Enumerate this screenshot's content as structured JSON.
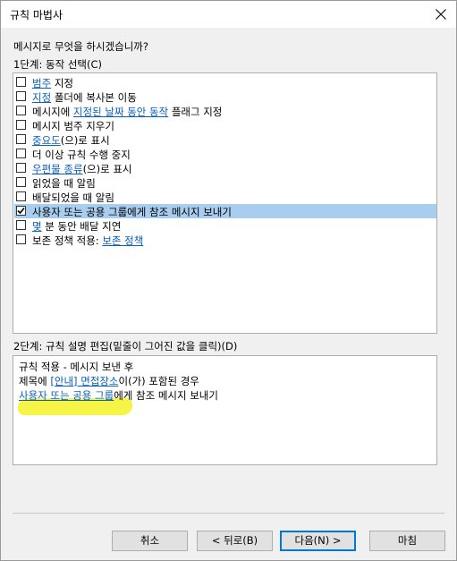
{
  "window": {
    "title": "규칙 마법사"
  },
  "question": "메시지로 무엇을 하시겠습니까?",
  "step1_label": "1단계: 동작 선택(C)",
  "actions": [
    {
      "checked": false,
      "link": "범주",
      "after": " 지정"
    },
    {
      "checked": false,
      "link": "지정",
      "after": " 폴더에 복사본 이동"
    },
    {
      "checked": false,
      "before": "메시지에 ",
      "link": "지정된 날짜 동안 동작",
      "after": " 플래그 지정"
    },
    {
      "checked": false,
      "before": "메시지 범주 지우기"
    },
    {
      "checked": false,
      "link": "중요도",
      "after": "(으)로 표시"
    },
    {
      "checked": false,
      "before": "더 이상 규칙 수행 중지"
    },
    {
      "checked": false,
      "link": "우편물 종류",
      "after": "(으)로 표시"
    },
    {
      "checked": false,
      "before": "읽었을 때 알림"
    },
    {
      "checked": false,
      "before": "배달되었을 때 알림"
    },
    {
      "checked": true,
      "selected": true,
      "before": "사용자 또는 공용 그룹에게 참조 메시지 보내기"
    },
    {
      "checked": false,
      "link": "몇",
      "after": " 분 동안 배달 지연"
    },
    {
      "checked": false,
      "before": "보존 정책 적용: ",
      "link": "보존 정책"
    }
  ],
  "step2_label": "2단계: 규칙 설명 편집(밑줄이 그어진 값을 클릭)(D)",
  "description": {
    "line1": "규칙 적용 - 메시지 보낸 후",
    "line2_before": "제목에 ",
    "line2_link": "[안내] 면접장소",
    "line2_after": "이(가) 포함된 경우",
    "line3_link": "사용자 또는 공용 그룹",
    "line3_after": "에게 참조 메시지 보내기"
  },
  "buttons": {
    "cancel": "취소",
    "back": "< 뒤로(B)",
    "next": "다음(N) >",
    "finish": "마침"
  },
  "colors": {
    "link": "#0b5fbf",
    "selection": "#a8cdef",
    "highlighter": "#f6f33c",
    "default_button_border": "#0078d7"
  }
}
